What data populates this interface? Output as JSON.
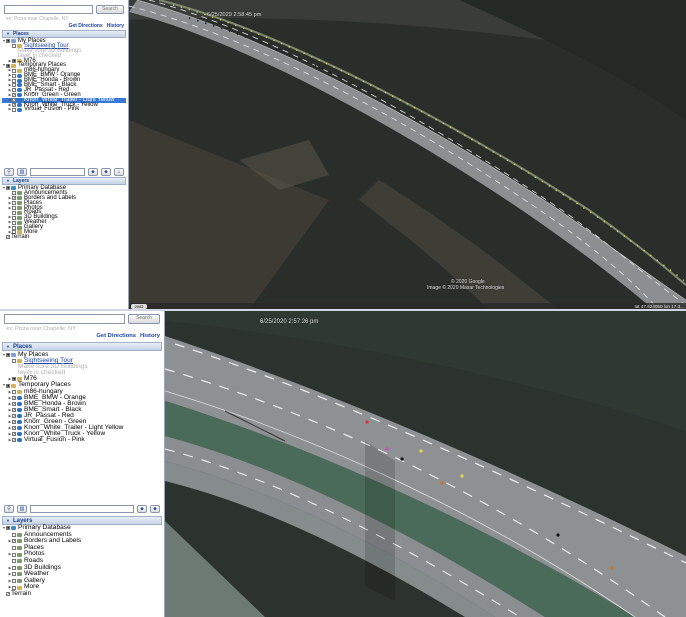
{
  "top": {
    "search": {
      "button": "Search",
      "hint": "ex: Pizza near Chapelle, NY"
    },
    "links": {
      "directions": "Get Directions",
      "history": "History"
    },
    "places_header": "Places",
    "places": [
      {
        "label": "My Places",
        "level": 0,
        "exp": "▼",
        "check": "■",
        "icon": "places"
      },
      {
        "label": "Sightseeing Tour",
        "level": 1,
        "check": "",
        "icon": "folder",
        "style": "link"
      },
      {
        "label": "Make sure 3D Buildings",
        "level": 2,
        "style": "gray"
      },
      {
        "label": "layer is checked",
        "level": 2,
        "style": "gray"
      },
      {
        "label": "M76",
        "level": 1,
        "exp": "▶",
        "check": "■",
        "icon": "folder"
      },
      {
        "label": "Temporary Places",
        "level": 0,
        "exp": "▼",
        "check": "■",
        "icon": "folder"
      },
      {
        "label": "m86-hungary",
        "level": 1,
        "exp": "▶",
        "check": "",
        "icon": "folder"
      },
      {
        "label": "BME_BMW - Orange",
        "level": 1,
        "exp": "▶",
        "check": "",
        "icon": "wave"
      },
      {
        "label": "BME_Honda - Brown",
        "level": 1,
        "exp": "▶",
        "check": "",
        "icon": "wave"
      },
      {
        "label": "BME_Smart - Black",
        "level": 1,
        "exp": "▶",
        "check": "",
        "icon": "wave"
      },
      {
        "label": "JR_Passat - Red",
        "level": 1,
        "exp": "▶",
        "check": "",
        "icon": "wave"
      },
      {
        "label": "Knorr_Green - Green",
        "level": 1,
        "exp": "▶",
        "check": "✓",
        "icon": "wave"
      },
      {
        "label": "Knorr_White_Trailer - Light Yellow",
        "level": 1,
        "exp": "▶",
        "check": "✓",
        "icon": "wave",
        "selected": true
      },
      {
        "label": "Knorr_White_Truck - Yellow",
        "level": 1,
        "exp": "▶",
        "check": "✓",
        "icon": "wave"
      },
      {
        "label": "Virtual_Fusion - Pink",
        "level": 1,
        "exp": "▶",
        "check": "",
        "icon": "wave"
      }
    ],
    "layers_header": "Layers",
    "layers": [
      {
        "label": "Primary Database",
        "level": 0,
        "exp": "▼",
        "check": "■",
        "icon": "db"
      },
      {
        "label": "Announcements",
        "level": 1,
        "check": "",
        "icon": "layer"
      },
      {
        "label": "Borders and Labels",
        "level": 1,
        "exp": "▶",
        "check": "✓",
        "icon": "layer"
      },
      {
        "label": "Places",
        "level": 1,
        "exp": "▶",
        "check": "",
        "icon": "layer"
      },
      {
        "label": "Photos",
        "level": 1,
        "exp": "▶",
        "check": "",
        "icon": "layer"
      },
      {
        "label": "Roads",
        "level": 1,
        "check": "",
        "icon": "layer"
      },
      {
        "label": "3D Buildings",
        "level": 1,
        "exp": "▶",
        "check": "",
        "icon": "layer"
      },
      {
        "label": "Weather",
        "level": 1,
        "exp": "▶",
        "check": "",
        "icon": "layer"
      },
      {
        "label": "Gallery",
        "level": 1,
        "exp": "▶",
        "check": "",
        "icon": "layer"
      },
      {
        "label": "More",
        "level": 1,
        "exp": "▶",
        "check": "",
        "icon": "folder"
      },
      {
        "label": "Terrain",
        "level": 0,
        "check": "✓",
        "icon": ""
      }
    ],
    "map": {
      "timestamp": "6/25/2020  2:58:45 pm",
      "copyright_1": "© 2020 Google",
      "copyright_2": "Image © 2020 Maxar Technologies",
      "status": "Iat  47.624050 lon  17.3...",
      "year": "2002"
    }
  },
  "bottom": {
    "search": {
      "button": "Search",
      "hint": "ex: Pizza near Chapelle, NY"
    },
    "links": {
      "directions": "Get Directions",
      "history": "History"
    },
    "places_header": "Places",
    "places": [
      {
        "label": "My Places",
        "level": 0,
        "exp": "▼",
        "check": "■",
        "icon": "places"
      },
      {
        "label": "Sightseeing Tour",
        "level": 1,
        "check": "",
        "icon": "folder",
        "style": "link"
      },
      {
        "label": "Make sure 3D Buildings",
        "level": 2,
        "style": "gray"
      },
      {
        "label": "layer is checked",
        "level": 2,
        "style": "gray"
      },
      {
        "label": "M76",
        "level": 1,
        "exp": "▶",
        "check": "■",
        "icon": "folder"
      },
      {
        "label": "Temporary Places",
        "level": 0,
        "exp": "▼",
        "check": "■",
        "icon": "folder"
      },
      {
        "label": "m86-hungary",
        "level": 1,
        "exp": "▶",
        "check": "",
        "icon": "folder"
      },
      {
        "label": "BME_BMW - Orange",
        "level": 1,
        "exp": "▶",
        "check": "✓",
        "icon": "wave"
      },
      {
        "label": "BME_Honda - Brown",
        "level": 1,
        "exp": "▶",
        "check": "✓",
        "icon": "wave"
      },
      {
        "label": "BME_Smart - Black",
        "level": 1,
        "exp": "▶",
        "check": "✓",
        "icon": "wave"
      },
      {
        "label": "JR_Passat - Red",
        "level": 1,
        "exp": "▶",
        "check": "✓",
        "icon": "wave"
      },
      {
        "label": "Knorr_Green - Green",
        "level": 1,
        "exp": "▶",
        "check": "✓",
        "icon": "wave"
      },
      {
        "label": "Knorr_White_Trailer - Light Yellow",
        "level": 1,
        "exp": "▶",
        "check": "✓",
        "icon": "wave"
      },
      {
        "label": "Knorr_White_Truck - Yellow",
        "level": 1,
        "exp": "▶",
        "check": "✓",
        "icon": "wave"
      },
      {
        "label": "Virtual_Fusion - Pink",
        "level": 1,
        "exp": "▶",
        "check": "✓",
        "icon": "wave"
      }
    ],
    "layers_header": "Layers",
    "layers": [
      {
        "label": "Primary Database",
        "level": 0,
        "exp": "▼",
        "check": "■",
        "icon": "db"
      },
      {
        "label": "Announcements",
        "level": 1,
        "check": "",
        "icon": "layer"
      },
      {
        "label": "Borders and Labels",
        "level": 1,
        "exp": "▶",
        "check": "✓",
        "icon": "layer"
      },
      {
        "label": "Places",
        "level": 1,
        "exp": "",
        "check": "",
        "icon": "layer"
      },
      {
        "label": "Photos",
        "level": 1,
        "exp": "▶",
        "check": "",
        "icon": "layer"
      },
      {
        "label": "Roads",
        "level": 1,
        "check": "",
        "icon": "layer"
      },
      {
        "label": "3D Buildings",
        "level": 1,
        "exp": "▶",
        "check": "",
        "icon": "layer"
      },
      {
        "label": "Weather",
        "level": 1,
        "exp": "▶",
        "check": "",
        "icon": "layer"
      },
      {
        "label": "Gallery",
        "level": 1,
        "exp": "▶",
        "check": "",
        "icon": "layer"
      },
      {
        "label": "More",
        "level": 1,
        "exp": "▶",
        "check": "",
        "icon": "folder"
      },
      {
        "label": "Terrain",
        "level": 0,
        "check": "✓",
        "icon": ""
      }
    ],
    "map": {
      "timestamp": "6/25/2020  2:57:26 pm"
    }
  },
  "colors": {
    "selection": "#3979d6",
    "link": "#1a43a6",
    "header_text": "#1a3f8f",
    "marker_yellow": "#e7d84a",
    "marker_red": "#d8342a",
    "marker_pink": "#d54ac0",
    "marker_black": "#111111",
    "marker_orange": "#d46a1e",
    "marker_brown": "#8a5a2a"
  }
}
